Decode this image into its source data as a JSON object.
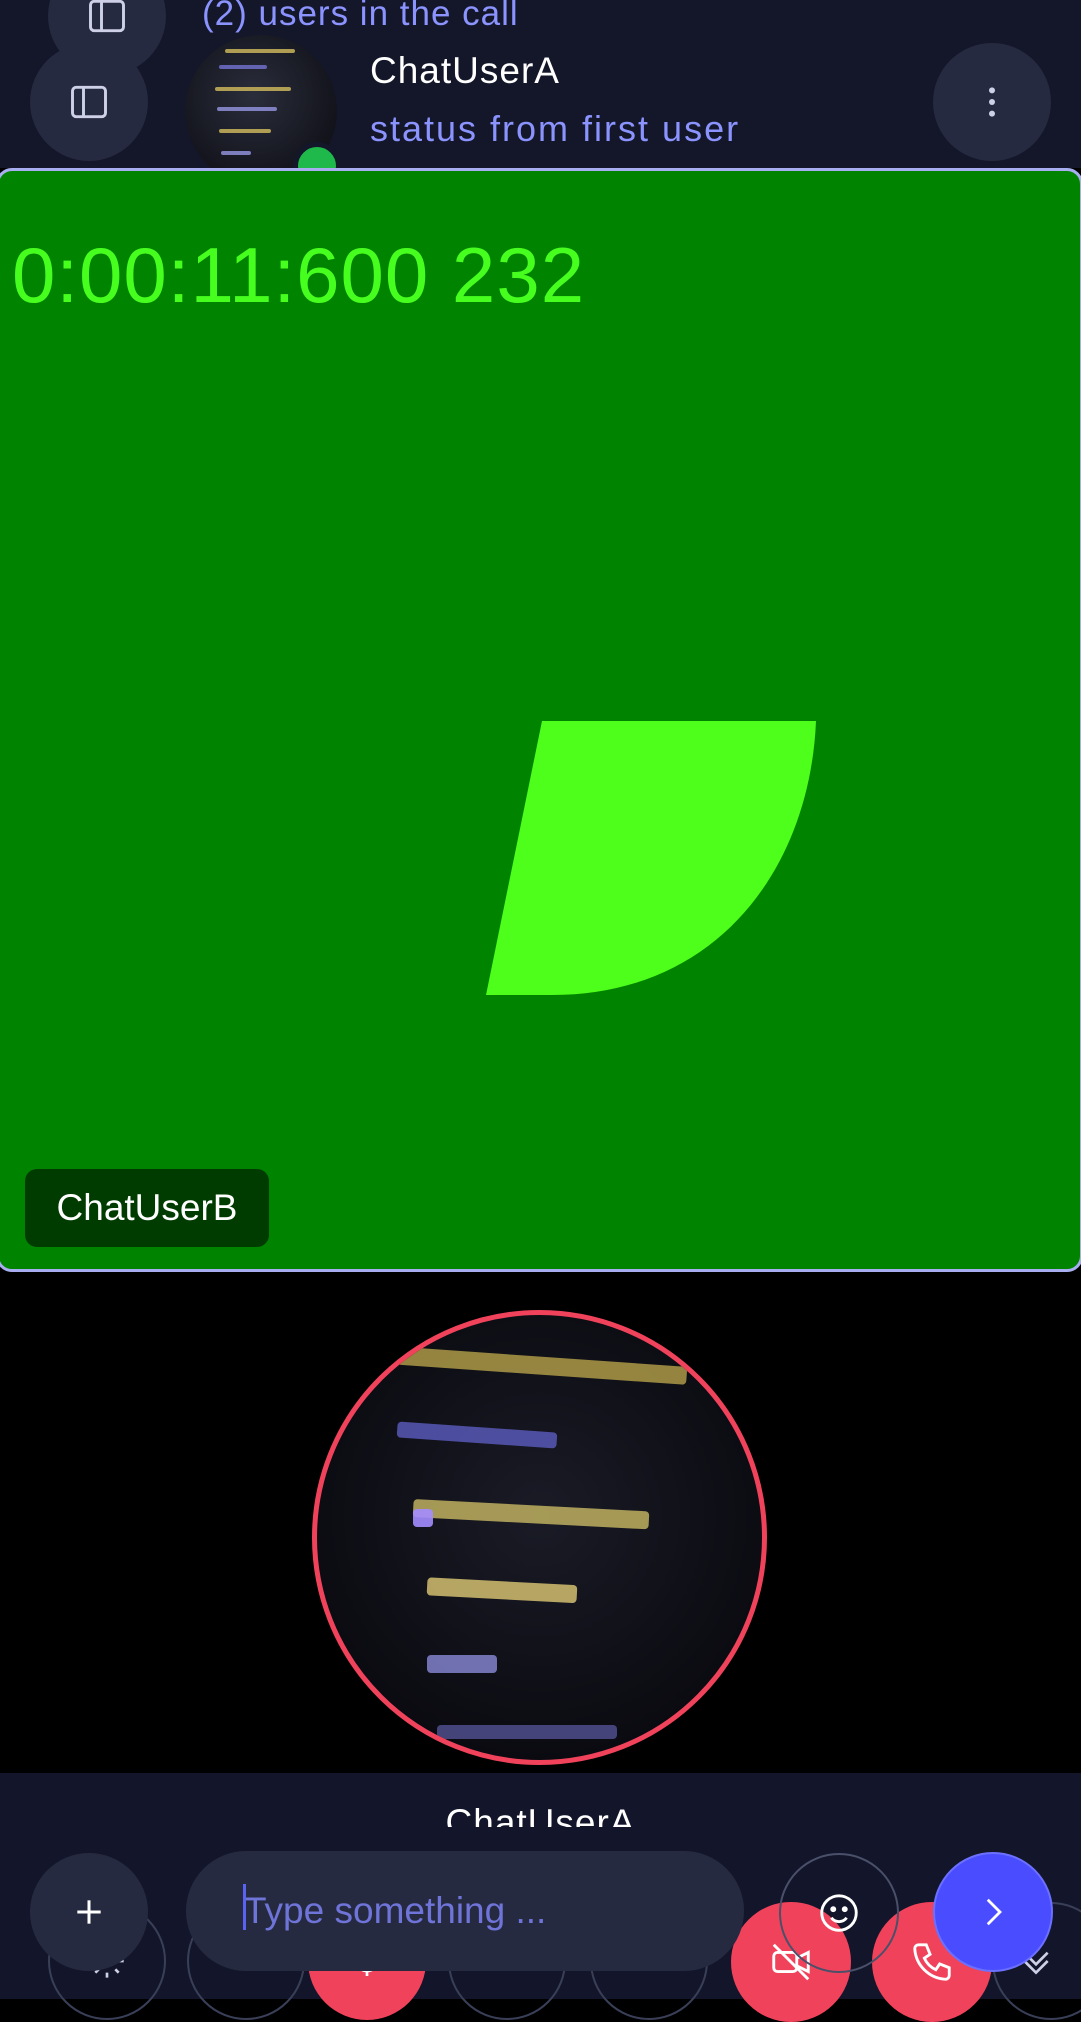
{
  "header": {
    "call_count": "(2) users in the call",
    "user_name": "ChatUserA",
    "user_status": "status from first user",
    "online": true
  },
  "remote_video": {
    "timer": "0:00:11:600 232",
    "participant_label": "ChatUserB"
  },
  "local_video": {
    "participant_label": "ChatUserA"
  },
  "composer": {
    "placeholder": "Type something ..."
  },
  "colors": {
    "accent": "#5a62f2",
    "danger": "#f0435b",
    "online": "#1fb84b",
    "video_bg": "#008400",
    "video_fg": "#46ff1f"
  },
  "icons": [
    "sidebar-icon",
    "more-vertical-icon",
    "plus-icon",
    "emoji-icon",
    "send-icon",
    "video-off-icon",
    "phone-icon",
    "chevron-double-down-icon",
    "settings-icon",
    "microphone-icon"
  ]
}
